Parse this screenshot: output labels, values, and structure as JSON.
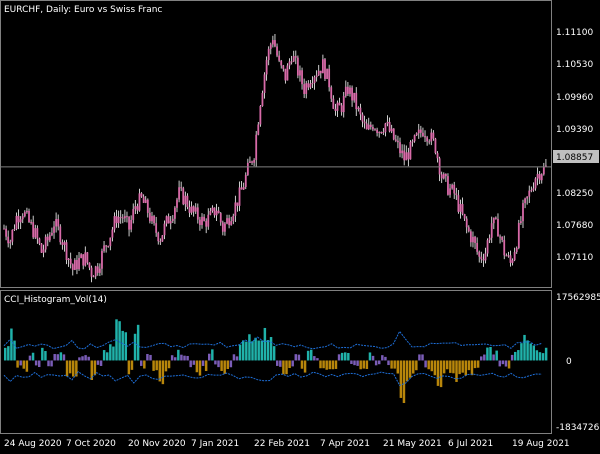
{
  "window": {
    "title": "EURCHF, Daily:  Euro vs Swiss Franc",
    "indicator_title": "CCI_Histogram_Vol(14)"
  },
  "colors": {
    "background": "#000000",
    "candle_body": "#d86aa8",
    "candle_wick": "#ffffff",
    "price_line": "#7f7f7f",
    "price_tag_bg": "#c0c0c0",
    "hist_positive": "#20b2aa",
    "hist_negative": "#b8860b",
    "hist_mid": "#7b5db8",
    "band": "#1e6fd9",
    "separator": "#808080"
  },
  "price_axis": {
    "ticks": [
      "1.11100",
      "1.10530",
      "1.09960",
      "1.09390",
      "1.08825",
      "1.08250",
      "1.07680",
      "1.07110"
    ],
    "current_price": "1.08857"
  },
  "indicator_axis": {
    "ticks": [
      "17562985",
      "0",
      "-18347262"
    ]
  },
  "time_axis": {
    "ticks": [
      "24 Aug 2020",
      "7 Oct 2020",
      "20 Nov 2020",
      "7 Jan 2021",
      "22 Feb 2021",
      "7 Apr 2021",
      "21 May 2021",
      "6 Jul 2021",
      "19 Aug 2021"
    ]
  },
  "chart_data": {
    "type": "candlestick",
    "symbol": "EURCHF",
    "timeframe": "Daily",
    "title": "EURCHF, Daily:  Euro vs Swiss Franc",
    "y_range": [
      1.0685,
      1.1165
    ],
    "close_path": [
      1.078,
      1.076,
      1.08,
      1.081,
      1.079,
      1.077,
      1.074,
      1.076,
      1.079,
      1.077,
      1.074,
      1.071,
      1.0725,
      1.073,
      1.0705,
      1.0715,
      1.0745,
      1.077,
      1.08,
      1.08,
      1.078,
      1.082,
      1.083,
      1.081,
      1.078,
      1.0765,
      1.079,
      1.081,
      1.084,
      1.083,
      1.081,
      1.08,
      1.079,
      1.08,
      1.0815,
      1.078,
      1.08,
      1.082,
      1.0845,
      1.088,
      1.091,
      1.1,
      1.107,
      1.111,
      1.106,
      1.104,
      1.108,
      1.105,
      1.102,
      1.104,
      1.105,
      1.106,
      1.103,
      1.098,
      1.099,
      1.102,
      1.1,
      1.097,
      1.0945,
      1.096,
      1.095,
      1.096,
      1.094,
      1.092,
      1.09,
      1.0915,
      1.0935,
      1.095,
      1.094,
      1.092,
      1.087,
      1.085,
      1.084,
      1.081,
      1.078,
      1.076,
      1.073,
      1.074,
      1.079,
      1.078,
      1.074,
      1.072,
      1.076,
      1.081,
      1.084,
      1.087,
      1.088,
      1.0886
    ],
    "indicator": {
      "name": "CCI_Histogram_Vol(14)",
      "y_range": [
        -18347262,
        17562985
      ],
      "histogram": [
        3500000,
        9000000,
        -2000000,
        -3000000,
        2000000,
        -1500000,
        3000000,
        -2500000,
        1500000,
        2000000,
        -4000000,
        -6000000,
        1000000,
        1500000,
        -5000000,
        -2000000,
        2500000,
        4000000,
        9500000,
        7000000,
        -3500000,
        8000000,
        -2500000,
        1500000,
        -4500000,
        -6000000,
        -3000000,
        1200000,
        2500000,
        1800000,
        -2000000,
        -4000000,
        -2500000,
        3000000,
        -1500000,
        -3500000,
        -2000000,
        1500000,
        4500000,
        6000000,
        5500000,
        9000000,
        7500000,
        6000000,
        -2500000,
        -3500000,
        -2000000,
        1500000,
        -3000000,
        2500000,
        1000000,
        -2000000,
        -3500000,
        -2500000,
        1800000,
        2500000,
        -1500000,
        -2500000,
        -2000000,
        2000000,
        -1500000,
        1500000,
        -2000000,
        -3000000,
        -15000000,
        -8000000,
        -3500000,
        1500000,
        -2000000,
        -4500000,
        -6000000,
        -4000000,
        -3000000,
        -5500000,
        -4500000,
        -3500000,
        -2000000,
        1500000,
        3500000,
        2500000,
        -1500000,
        -2000000,
        2000000,
        4000000,
        6500000,
        5000000,
        2500000,
        3000000
      ]
    }
  }
}
